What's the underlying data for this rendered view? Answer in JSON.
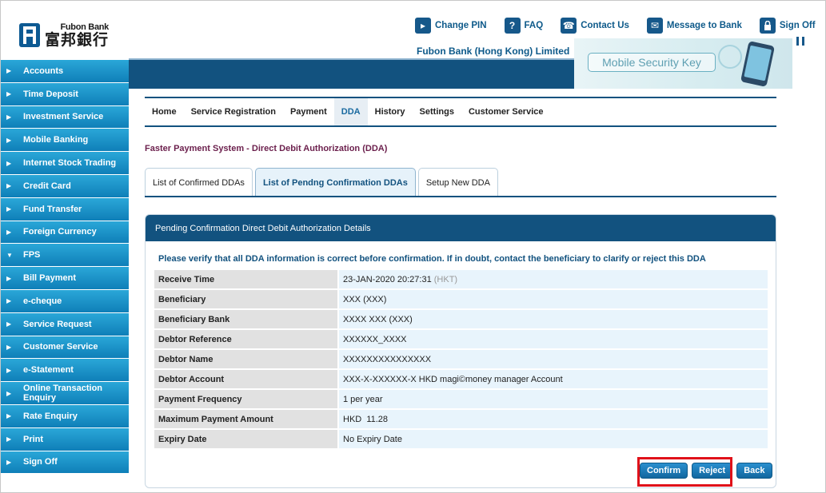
{
  "logo": {
    "en": "Fubon Bank",
    "zh": "富邦銀行"
  },
  "toplinks": [
    {
      "icon": "arrow-right-icon",
      "glyph": "▸",
      "label": "Change PIN"
    },
    {
      "icon": "question-icon",
      "glyph": "?",
      "label": "FAQ"
    },
    {
      "icon": "phone-icon",
      "glyph": "☎",
      "label": "Contact Us"
    },
    {
      "icon": "envelope-icon",
      "glyph": "✉",
      "label": "Message to Bank"
    },
    {
      "icon": "lock-icon",
      "glyph": "🔒",
      "label": "Sign Off"
    }
  ],
  "bank_name": "Fubon Bank (Hong Kong) Limited",
  "banner": {
    "text": "Mobile Security Key"
  },
  "sidebar": [
    {
      "label": "Accounts",
      "expanded": false
    },
    {
      "label": "Time Deposit",
      "expanded": false
    },
    {
      "label": "Investment Service",
      "expanded": false
    },
    {
      "label": "Mobile Banking",
      "expanded": false
    },
    {
      "label": "Internet Stock Trading",
      "expanded": false
    },
    {
      "label": "Credit Card",
      "expanded": false
    },
    {
      "label": "Fund Transfer",
      "expanded": false
    },
    {
      "label": "Foreign Currency",
      "expanded": false
    },
    {
      "label": "FPS",
      "expanded": true
    },
    {
      "label": "Bill Payment",
      "expanded": false
    },
    {
      "label": "e-cheque",
      "expanded": false
    },
    {
      "label": "Service Request",
      "expanded": false
    },
    {
      "label": "Customer Service",
      "expanded": false
    },
    {
      "label": "e-Statement",
      "expanded": false
    },
    {
      "label": "Online Transaction Enquiry",
      "expanded": false
    },
    {
      "label": "Rate Enquiry",
      "expanded": false
    },
    {
      "label": "Print",
      "expanded": false
    },
    {
      "label": "Sign Off",
      "expanded": false
    }
  ],
  "mainnav": {
    "active": "DDA",
    "items": [
      "Home",
      "Service Registration",
      "Payment",
      "DDA",
      "History",
      "Settings",
      "Customer Service"
    ]
  },
  "page_title": "Faster Payment System - Direct Debit Authorization (DDA)",
  "subtabs": {
    "active": "List of Pendng Confirmation DDAs",
    "items": [
      "List of Confirmed DDAs",
      "List of Pendng Confirmation DDAs",
      "Setup New DDA"
    ]
  },
  "panel": {
    "title": "Pending Confirmation Direct Debit Authorization Details",
    "notice": "Please verify that all DDA information is correct before confirmation. If in doubt, contact the beneficiary to clarify or reject this DDA",
    "rows": [
      {
        "label": "Receive Time",
        "value": "23-JAN-2020 20:27:31",
        "suffix": "(HKT)"
      },
      {
        "label": "Beneficiary",
        "value": "XXX (XXX)",
        "suffix": ""
      },
      {
        "label": "Beneficiary Bank",
        "value": "XXXX XXX (XXX)",
        "suffix": ""
      },
      {
        "label": "Debtor Reference",
        "value": "XXXXXX_XXXX",
        "suffix": ""
      },
      {
        "label": "Debtor Name",
        "value": "XXXXXXXXXXXXXXX",
        "suffix": ""
      },
      {
        "label": "Debtor Account",
        "value": "XXX-X-XXXXXX-X HKD magi©money manager Account",
        "suffix": ""
      },
      {
        "label": "Payment Frequency",
        "value": "1 per year",
        "suffix": ""
      },
      {
        "label": "Maximum Payment Amount",
        "value": "HKD  11.28",
        "suffix": ""
      },
      {
        "label": "Expiry Date",
        "value": "No Expiry Date",
        "suffix": ""
      }
    ]
  },
  "actions": {
    "confirm": "Confirm",
    "reject": "Reject",
    "back": "Back"
  },
  "colors": {
    "brand": "#12527f",
    "sidebar": "#1a8fc8",
    "title": "#6b1f4c",
    "highlight": "#e0121a"
  }
}
